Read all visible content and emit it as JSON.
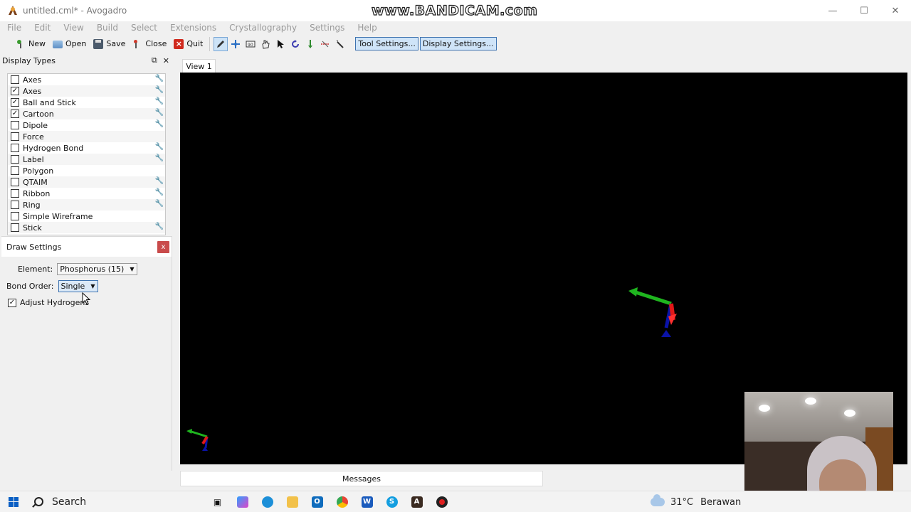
{
  "window": {
    "title": "untitled.cml* - Avogadro",
    "watermark": "www.BANDICAM.com",
    "controls": [
      "—",
      "☐",
      "✕"
    ]
  },
  "menu": [
    "File",
    "Edit",
    "View",
    "Build",
    "Select",
    "Extensions",
    "Crystallography",
    "Settings",
    "Help"
  ],
  "toolbar": {
    "new": "New",
    "open": "Open",
    "save": "Save",
    "close": "Close",
    "quit": "Quit",
    "tool_settings": "Tool Settings...",
    "display_settings": "Display Settings..."
  },
  "display_types": {
    "title": "Display Types",
    "items": [
      {
        "label": "Axes",
        "checked": false,
        "settings": true
      },
      {
        "label": "Axes",
        "checked": true,
        "settings": true
      },
      {
        "label": "Ball and Stick",
        "checked": true,
        "settings": true
      },
      {
        "label": "Cartoon",
        "checked": true,
        "settings": true
      },
      {
        "label": "Dipole",
        "checked": false,
        "settings": true
      },
      {
        "label": "Force",
        "checked": false,
        "settings": false
      },
      {
        "label": "Hydrogen Bond",
        "checked": false,
        "settings": true
      },
      {
        "label": "Label",
        "checked": false,
        "settings": true
      },
      {
        "label": "Polygon",
        "checked": false,
        "settings": false
      },
      {
        "label": "QTAIM",
        "checked": false,
        "settings": true
      },
      {
        "label": "Ribbon",
        "checked": false,
        "settings": true
      },
      {
        "label": "Ring",
        "checked": false,
        "settings": true
      },
      {
        "label": "Simple Wireframe",
        "checked": false,
        "settings": false
      },
      {
        "label": "Stick",
        "checked": false,
        "settings": true
      }
    ]
  },
  "draw_settings": {
    "title": "Draw Settings",
    "close": "x",
    "element_label": "Element:",
    "element_value": "Phosphorus (15)",
    "bond_order_label": "Bond Order:",
    "bond_order_value": "Single",
    "adjust_hydrogens_label": "Adjust Hydrogens",
    "adjust_hydrogens_checked": true
  },
  "view": {
    "tab": "View 1",
    "messages": "Messages"
  },
  "taskbar": {
    "search": "Search",
    "temperature": "31°C",
    "weather": "Berawan"
  },
  "colors": {
    "viewport_bg": "#000000",
    "axis_x": "#e02020",
    "axis_y": "#20c020",
    "axis_z": "#2030d0",
    "setting_button_bg": "#cfe4f8",
    "setting_button_border": "#3e73b0"
  }
}
